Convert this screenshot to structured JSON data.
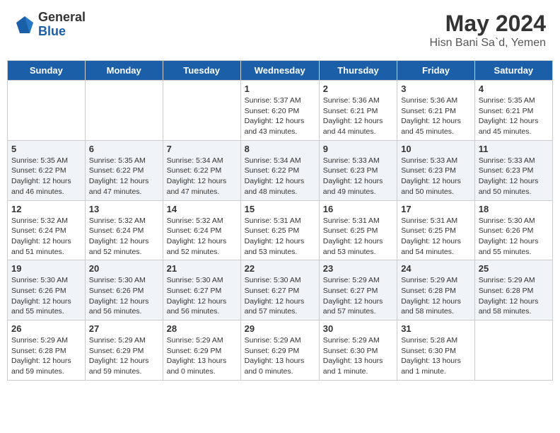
{
  "header": {
    "logo_general": "General",
    "logo_blue": "Blue",
    "month_year": "May 2024",
    "location": "Hisn Bani Sa`d, Yemen"
  },
  "days_of_week": [
    "Sunday",
    "Monday",
    "Tuesday",
    "Wednesday",
    "Thursday",
    "Friday",
    "Saturday"
  ],
  "weeks": [
    [
      {
        "day": "",
        "info": ""
      },
      {
        "day": "",
        "info": ""
      },
      {
        "day": "",
        "info": ""
      },
      {
        "day": "1",
        "info": "Sunrise: 5:37 AM\nSunset: 6:20 PM\nDaylight: 12 hours\nand 43 minutes."
      },
      {
        "day": "2",
        "info": "Sunrise: 5:36 AM\nSunset: 6:21 PM\nDaylight: 12 hours\nand 44 minutes."
      },
      {
        "day": "3",
        "info": "Sunrise: 5:36 AM\nSunset: 6:21 PM\nDaylight: 12 hours\nand 45 minutes."
      },
      {
        "day": "4",
        "info": "Sunrise: 5:35 AM\nSunset: 6:21 PM\nDaylight: 12 hours\nand 45 minutes."
      }
    ],
    [
      {
        "day": "5",
        "info": "Sunrise: 5:35 AM\nSunset: 6:22 PM\nDaylight: 12 hours\nand 46 minutes."
      },
      {
        "day": "6",
        "info": "Sunrise: 5:35 AM\nSunset: 6:22 PM\nDaylight: 12 hours\nand 47 minutes."
      },
      {
        "day": "7",
        "info": "Sunrise: 5:34 AM\nSunset: 6:22 PM\nDaylight: 12 hours\nand 47 minutes."
      },
      {
        "day": "8",
        "info": "Sunrise: 5:34 AM\nSunset: 6:22 PM\nDaylight: 12 hours\nand 48 minutes."
      },
      {
        "day": "9",
        "info": "Sunrise: 5:33 AM\nSunset: 6:23 PM\nDaylight: 12 hours\nand 49 minutes."
      },
      {
        "day": "10",
        "info": "Sunrise: 5:33 AM\nSunset: 6:23 PM\nDaylight: 12 hours\nand 50 minutes."
      },
      {
        "day": "11",
        "info": "Sunrise: 5:33 AM\nSunset: 6:23 PM\nDaylight: 12 hours\nand 50 minutes."
      }
    ],
    [
      {
        "day": "12",
        "info": "Sunrise: 5:32 AM\nSunset: 6:24 PM\nDaylight: 12 hours\nand 51 minutes."
      },
      {
        "day": "13",
        "info": "Sunrise: 5:32 AM\nSunset: 6:24 PM\nDaylight: 12 hours\nand 52 minutes."
      },
      {
        "day": "14",
        "info": "Sunrise: 5:32 AM\nSunset: 6:24 PM\nDaylight: 12 hours\nand 52 minutes."
      },
      {
        "day": "15",
        "info": "Sunrise: 5:31 AM\nSunset: 6:25 PM\nDaylight: 12 hours\nand 53 minutes."
      },
      {
        "day": "16",
        "info": "Sunrise: 5:31 AM\nSunset: 6:25 PM\nDaylight: 12 hours\nand 53 minutes."
      },
      {
        "day": "17",
        "info": "Sunrise: 5:31 AM\nSunset: 6:25 PM\nDaylight: 12 hours\nand 54 minutes."
      },
      {
        "day": "18",
        "info": "Sunrise: 5:30 AM\nSunset: 6:26 PM\nDaylight: 12 hours\nand 55 minutes."
      }
    ],
    [
      {
        "day": "19",
        "info": "Sunrise: 5:30 AM\nSunset: 6:26 PM\nDaylight: 12 hours\nand 55 minutes."
      },
      {
        "day": "20",
        "info": "Sunrise: 5:30 AM\nSunset: 6:26 PM\nDaylight: 12 hours\nand 56 minutes."
      },
      {
        "day": "21",
        "info": "Sunrise: 5:30 AM\nSunset: 6:27 PM\nDaylight: 12 hours\nand 56 minutes."
      },
      {
        "day": "22",
        "info": "Sunrise: 5:30 AM\nSunset: 6:27 PM\nDaylight: 12 hours\nand 57 minutes."
      },
      {
        "day": "23",
        "info": "Sunrise: 5:29 AM\nSunset: 6:27 PM\nDaylight: 12 hours\nand 57 minutes."
      },
      {
        "day": "24",
        "info": "Sunrise: 5:29 AM\nSunset: 6:28 PM\nDaylight: 12 hours\nand 58 minutes."
      },
      {
        "day": "25",
        "info": "Sunrise: 5:29 AM\nSunset: 6:28 PM\nDaylight: 12 hours\nand 58 minutes."
      }
    ],
    [
      {
        "day": "26",
        "info": "Sunrise: 5:29 AM\nSunset: 6:28 PM\nDaylight: 12 hours\nand 59 minutes."
      },
      {
        "day": "27",
        "info": "Sunrise: 5:29 AM\nSunset: 6:29 PM\nDaylight: 12 hours\nand 59 minutes."
      },
      {
        "day": "28",
        "info": "Sunrise: 5:29 AM\nSunset: 6:29 PM\nDaylight: 13 hours\nand 0 minutes."
      },
      {
        "day": "29",
        "info": "Sunrise: 5:29 AM\nSunset: 6:29 PM\nDaylight: 13 hours\nand 0 minutes."
      },
      {
        "day": "30",
        "info": "Sunrise: 5:29 AM\nSunset: 6:30 PM\nDaylight: 13 hours\nand 1 minute."
      },
      {
        "day": "31",
        "info": "Sunrise: 5:28 AM\nSunset: 6:30 PM\nDaylight: 13 hours\nand 1 minute."
      },
      {
        "day": "",
        "info": ""
      }
    ]
  ]
}
